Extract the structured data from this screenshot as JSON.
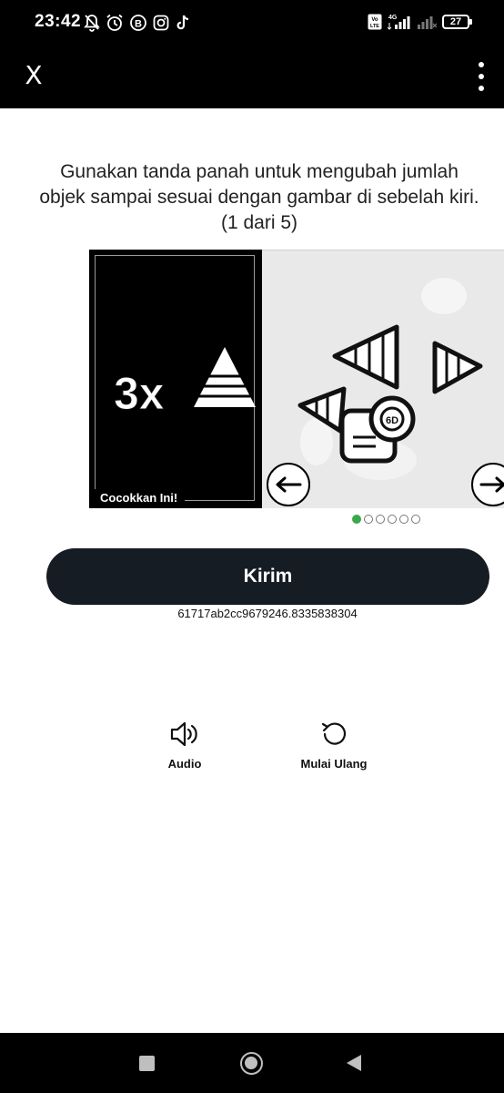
{
  "status_bar": {
    "time": "23:42",
    "left_icons": [
      "bell-off-icon",
      "alarm-icon",
      "b-app-icon",
      "instagram-icon",
      "tiktok-icon"
    ],
    "network_badge": "VoLTE",
    "network_type": "4G",
    "battery": "27"
  },
  "app_bar": {
    "close_label": "X",
    "menu_icon": "more-vert-icon"
  },
  "instruction": "Gunakan tanda panah untuk mengubah jumlah objek sampai sesuai dengan gambar di sebelah kiri. (1 dari 5)",
  "captcha": {
    "match_text": "3x",
    "match_label": "Cocokkan Ini!",
    "pagination": {
      "total": 6,
      "current": 1
    },
    "colors": {
      "active_dot": "#3aa84a"
    }
  },
  "submit_label": "Kirim",
  "session_id": "61717ab2cc9679246.8335838304",
  "tools": {
    "audio_label": "Audio",
    "restart_label": "Mulai Ulang"
  },
  "colors": {
    "submit_bg": "#161c24",
    "header_bg": "#000000"
  }
}
